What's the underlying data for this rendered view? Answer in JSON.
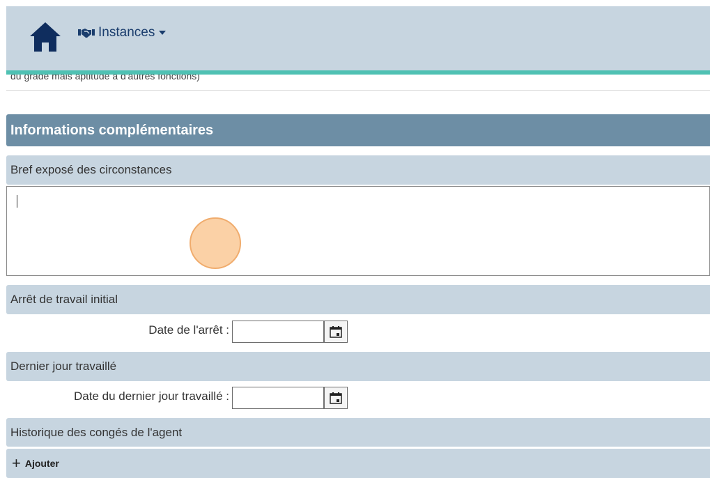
{
  "nav": {
    "menu_label": "Instances",
    "icons": {
      "home": "home-icon",
      "menu": "handshake-icon",
      "caret": "caret-down-icon"
    }
  },
  "truncated_text": "du grade mais aptitude à d'autres fonctions)",
  "section": {
    "title": "Informations complémentaires"
  },
  "circonstances": {
    "header": "Bref exposé des circonstances",
    "value": ""
  },
  "arret": {
    "header": "Arrêt de travail initial",
    "date_label": "Date de l'arrêt :",
    "date_value": ""
  },
  "dernier_jour": {
    "header": "Dernier jour travaillé",
    "date_label": "Date du dernier jour travaillé :",
    "date_value": ""
  },
  "historique": {
    "header": "Historique des congés de l'agent",
    "add_label": "Ajouter",
    "add_icon": "plus-icon"
  },
  "colors": {
    "nav_bg": "#c7d5e0",
    "accent_line": "#4fc1b3",
    "section_bg": "#6d8ea5",
    "subheader_bg": "#c7d5e0",
    "nav_text": "#1a3d6d"
  }
}
